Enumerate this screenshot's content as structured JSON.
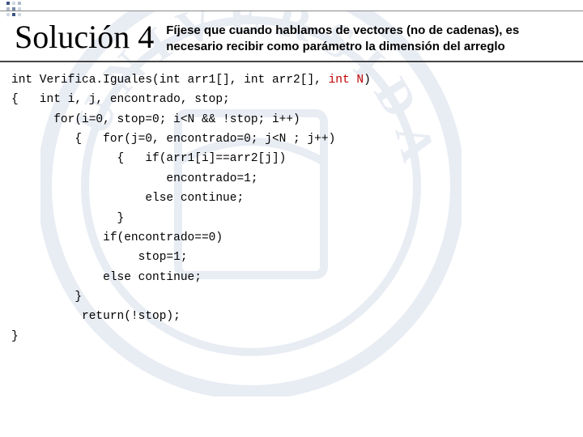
{
  "header": {
    "title": "Solución 4",
    "note": "Fíjese que cuando hablamos de vectores (no de cadenas), es necesario recibir como parámetro la dimensión del arreglo"
  },
  "code": {
    "l1a": "int Verifica.Iguales(int arr1[], int arr2[], ",
    "l1b": "int N",
    "l1c": ")",
    "l2": "{   int i, j, encontrado, stop;",
    "l3": "      for(i=0, stop=0; i<N && !stop; i++)",
    "l4": "         {   for(j=0, encontrado=0; j<N ; j++)",
    "l5": "               {   if(arr1[i]==arr2[j])",
    "l6": "                      encontrado=1;",
    "l7": "                   else continue;",
    "l8": "               }",
    "l9": "             if(encontrado==0)",
    "l10": "                  stop=1;",
    "l11": "             else continue;",
    "l12": "         }",
    "l13": "          return(!stop);",
    "l14": "}"
  }
}
